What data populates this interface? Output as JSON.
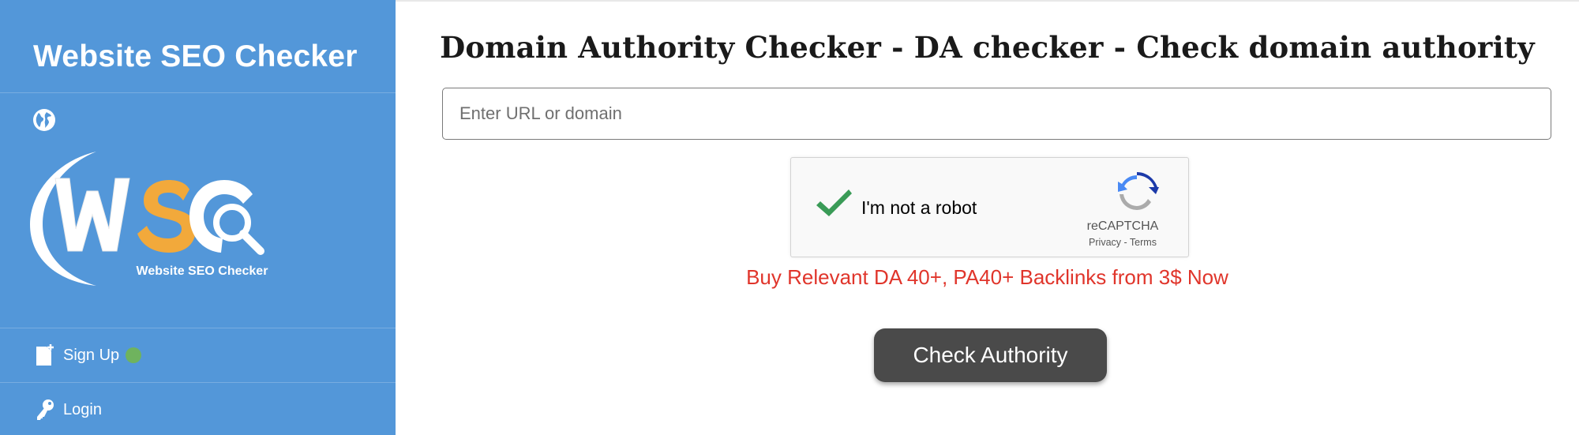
{
  "sidebar": {
    "brand": "Website SEO Checker",
    "logo_text": "Website SEO Checker",
    "logo_colors": {
      "w": "#ffffff",
      "s": "#f2a93b",
      "c": "#ffffff"
    },
    "items": [
      {
        "label": "Sign Up",
        "icon": "document-add-icon",
        "status": "online-dot"
      },
      {
        "label": "Login",
        "icon": "key-icon"
      }
    ],
    "background": "#5397d9"
  },
  "main": {
    "title": "Domain Authority Checker - DA checker - Check domain authority",
    "url_input": {
      "placeholder": "Enter URL or domain",
      "value": ""
    },
    "captcha": {
      "label": "I'm not a robot",
      "checked": true,
      "brand": "reCAPTCHA",
      "privacy": "Privacy",
      "separator": " - ",
      "terms": "Terms"
    },
    "promo_link": "Buy Relevant DA 40+, PA40+ Backlinks from 3$ Now",
    "submit_label": "Check Authority"
  },
  "colors": {
    "sidebar": "#5397d9",
    "promo": "#e0352b",
    "button": "#4a4a4a",
    "check": "#3a9b57"
  }
}
